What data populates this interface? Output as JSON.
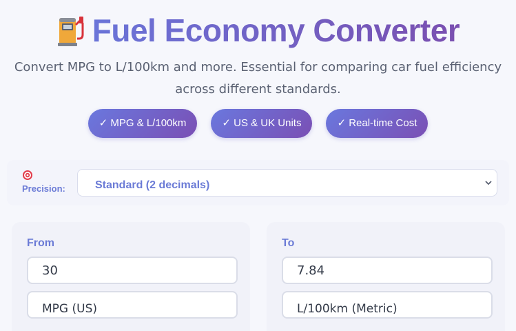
{
  "header": {
    "title": "Fuel Economy Converter",
    "title_icon": "fuel-pump-icon",
    "subtitle": "Convert MPG to L/100km and more. Essential for comparing car fuel efficiency across different standards."
  },
  "badges": [
    {
      "label": "✓ MPG & L/100km"
    },
    {
      "label": "✓ US & UK Units"
    },
    {
      "label": "✓ Real-time Cost"
    }
  ],
  "precision": {
    "icon": "target-icon",
    "label": "Precision:",
    "selected": "Standard (2 decimals)"
  },
  "from": {
    "label": "From",
    "value": "30",
    "unit": "MPG (US)"
  },
  "to": {
    "label": "To",
    "value": "7.84",
    "unit": "L/100km (Metric)"
  },
  "colors": {
    "accent": "#6b7bd6",
    "gradient_start": "#6a78de",
    "gradient_end": "#7a4fb4",
    "background": "#f6f7fc"
  }
}
